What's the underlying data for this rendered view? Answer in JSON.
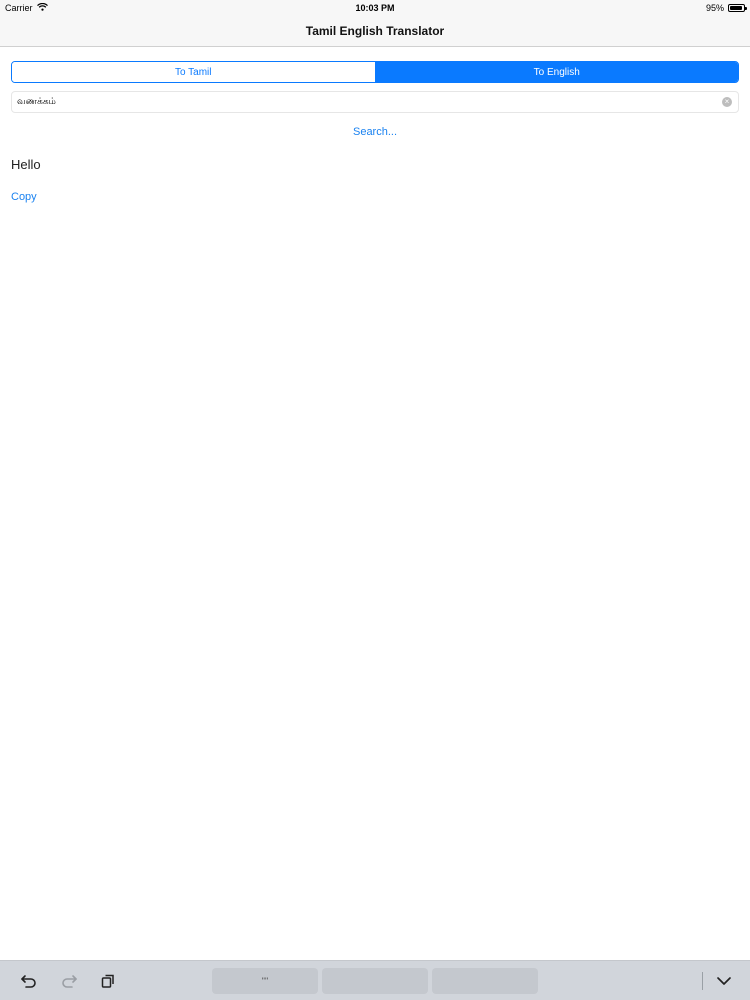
{
  "status_bar": {
    "carrier": "Carrier",
    "time": "10:03 PM",
    "battery_percent": "95%",
    "battery_level": 0.95
  },
  "nav": {
    "title": "Tamil English Translator"
  },
  "segmented_control": {
    "options": [
      "To Tamil",
      "To English"
    ],
    "selected": "To English"
  },
  "search": {
    "value": "வணக்கம்"
  },
  "search_button": {
    "label": "Search..."
  },
  "result": {
    "text": "Hello",
    "copy_label": "Copy"
  },
  "keyboard_bar": {
    "suggestion_keys": [
      "\"\"",
      "",
      ""
    ],
    "icons": [
      "undo-icon",
      "redo-icon",
      "paste-icon",
      "dismiss-keyboard-icon"
    ]
  },
  "colors": {
    "accent": "#0a7aff",
    "link": "#1a82f0",
    "keyboard_bg": "#d1d5db"
  }
}
